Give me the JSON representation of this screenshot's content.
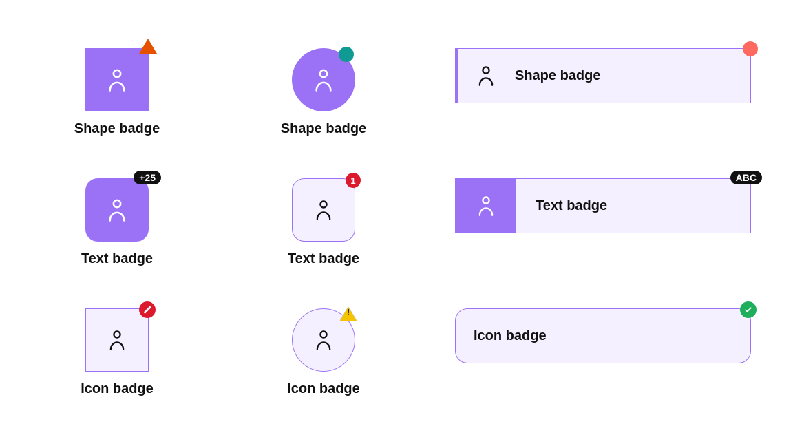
{
  "row1": {
    "col1": {
      "caption": "Shape badge"
    },
    "col2": {
      "caption": "Shape badge"
    },
    "bar": {
      "label": "Shape badge"
    }
  },
  "row2": {
    "col1": {
      "caption": "Text badge",
      "badge_text": "+25"
    },
    "col2": {
      "caption": "Text badge",
      "badge_text": "1"
    },
    "bar": {
      "label": "Text badge",
      "badge_text": "ABC"
    }
  },
  "row3": {
    "col1": {
      "caption": "Icon badge"
    },
    "col2": {
      "caption": "Icon badge"
    },
    "bar": {
      "label": "Icon badge"
    }
  },
  "colors": {
    "purple": "#9b71f6",
    "purple_light": "#f5f0ff",
    "teal": "#0f9b94",
    "coral": "#ff6960",
    "orange": "#e65100",
    "red": "#db1a2d",
    "yellow": "#f5c400",
    "green": "#1fae5b",
    "black": "#111111"
  }
}
